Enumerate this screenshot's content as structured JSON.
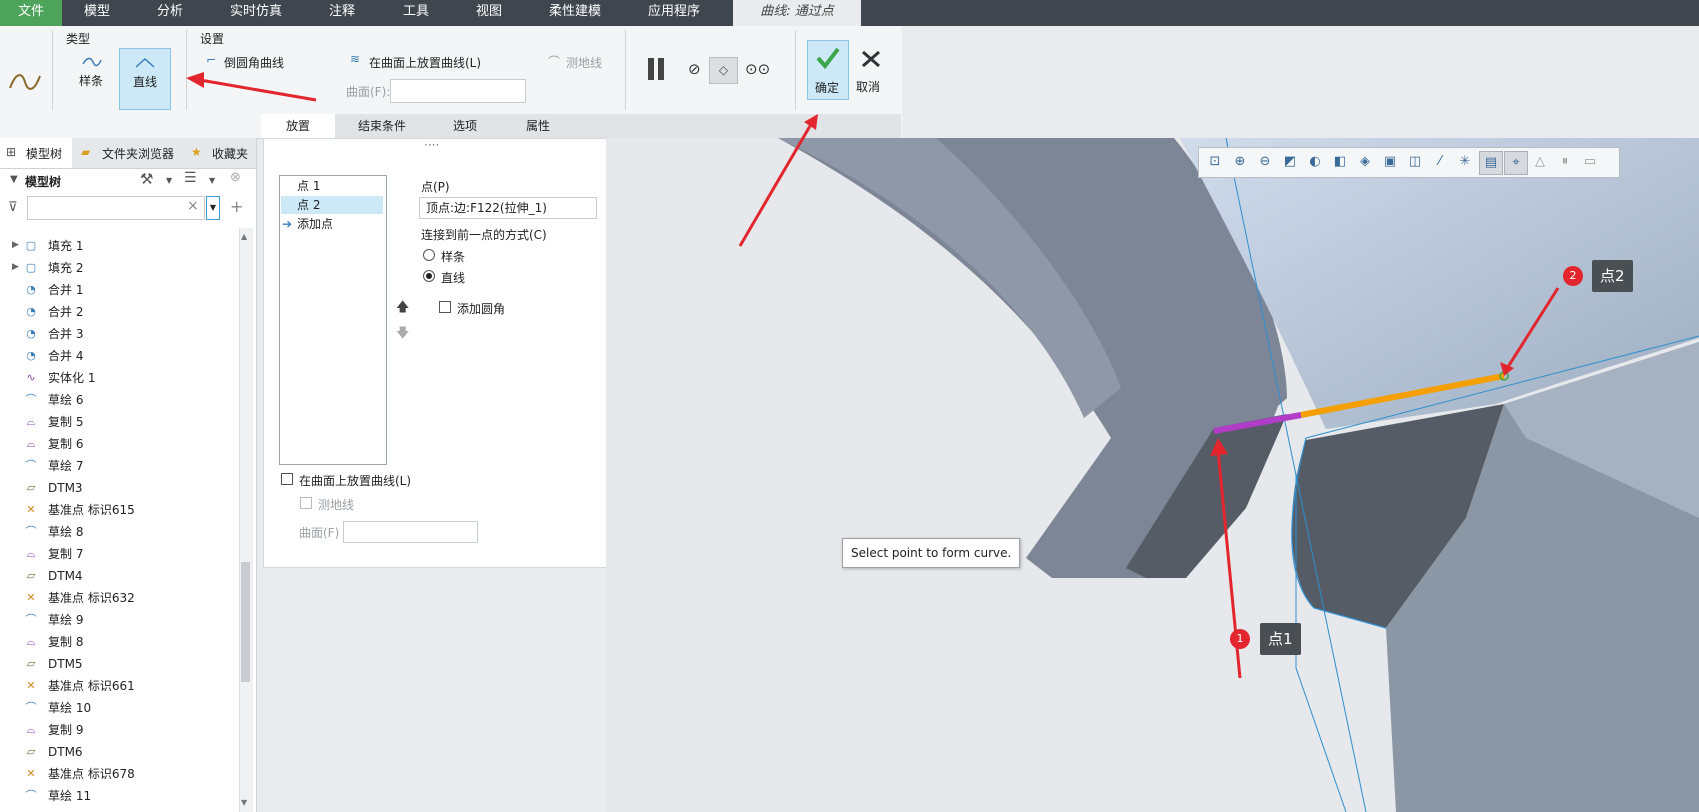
{
  "menu": {
    "file": "文件",
    "items": [
      "模型",
      "分析",
      "实时仿真",
      "注释",
      "工具",
      "视图",
      "柔性建模",
      "应用程序"
    ],
    "active_tab": "曲线: 通过点"
  },
  "ribbon": {
    "type_group": "类型",
    "spline": "样条",
    "line": "直线",
    "settings_group": "设置",
    "fillet_curve": "倒圆角曲线",
    "place_on_surface": "在曲面上放置曲线(L)",
    "geodesic": "测地线",
    "surface_label": "曲面(F):",
    "ok": "确定",
    "cancel": "取消",
    "tabs": [
      "放置",
      "结束条件",
      "选项",
      "属性"
    ],
    "dots": "····"
  },
  "left_panel": {
    "tabs": [
      "模型树",
      "文件夹浏览器",
      "收藏夹"
    ],
    "header": "模型树",
    "search_clear": "×",
    "tree": [
      {
        "label": "填充 1",
        "icon": "fill-icon",
        "expandable": true
      },
      {
        "label": "填充 2",
        "icon": "fill-icon",
        "expandable": true
      },
      {
        "label": "合并 1",
        "icon": "merge-icon"
      },
      {
        "label": "合并 2",
        "icon": "merge-icon"
      },
      {
        "label": "合并 3",
        "icon": "merge-icon"
      },
      {
        "label": "合并 4",
        "icon": "merge-icon"
      },
      {
        "label": "实体化 1",
        "icon": "solidify-icon"
      },
      {
        "label": "草绘 6",
        "icon": "sketch-icon"
      },
      {
        "label": "复制 5",
        "icon": "copy-icon"
      },
      {
        "label": "复制 6",
        "icon": "copy-icon"
      },
      {
        "label": "草绘 7",
        "icon": "sketch-icon"
      },
      {
        "label": "DTM3",
        "icon": "datum-plane-icon"
      },
      {
        "label": "基准点 标识615",
        "icon": "datum-point-icon"
      },
      {
        "label": "草绘 8",
        "icon": "sketch-icon"
      },
      {
        "label": "复制 7",
        "icon": "copy-icon"
      },
      {
        "label": "DTM4",
        "icon": "datum-plane-icon"
      },
      {
        "label": "基准点 标识632",
        "icon": "datum-point-icon"
      },
      {
        "label": "草绘 9",
        "icon": "sketch-icon"
      },
      {
        "label": "复制 8",
        "icon": "copy-icon"
      },
      {
        "label": "DTM5",
        "icon": "datum-plane-icon"
      },
      {
        "label": "基准点 标识661",
        "icon": "datum-point-icon"
      },
      {
        "label": "草绘 10",
        "icon": "sketch-icon"
      },
      {
        "label": "复制 9",
        "icon": "copy-icon"
      },
      {
        "label": "DTM6",
        "icon": "datum-plane-icon"
      },
      {
        "label": "基准点 标识678",
        "icon": "datum-point-icon"
      },
      {
        "label": "草绘 11",
        "icon": "sketch-icon"
      }
    ]
  },
  "placement": {
    "points": [
      "点 1",
      "点 2"
    ],
    "add_point": "添加点",
    "point_label": "点(P)",
    "point_value": "顶点:边:F122(拉伸_1)",
    "connect_label": "连接到前一点的方式(C)",
    "opt_spline": "样条",
    "opt_line": "直线",
    "add_fillet": "添加圆角",
    "place_on_surface": "在曲面上放置曲线(L)",
    "geodesic": "测地线",
    "surface_label": "曲面(F)"
  },
  "viewport": {
    "tooltip": "Select point to form curve.",
    "callout1": "点1",
    "callout2": "点2",
    "badge1": "1",
    "badge2": "2"
  },
  "colors": {
    "file_menu": "#4ea35a",
    "accent": "#3a9bd9",
    "ok_green": "#3ca64a",
    "callout_bg": "#4a4f54",
    "annotation_red": "#e3262d",
    "segment_orange": "#f5a000",
    "segment_purple": "#b03cc8"
  }
}
